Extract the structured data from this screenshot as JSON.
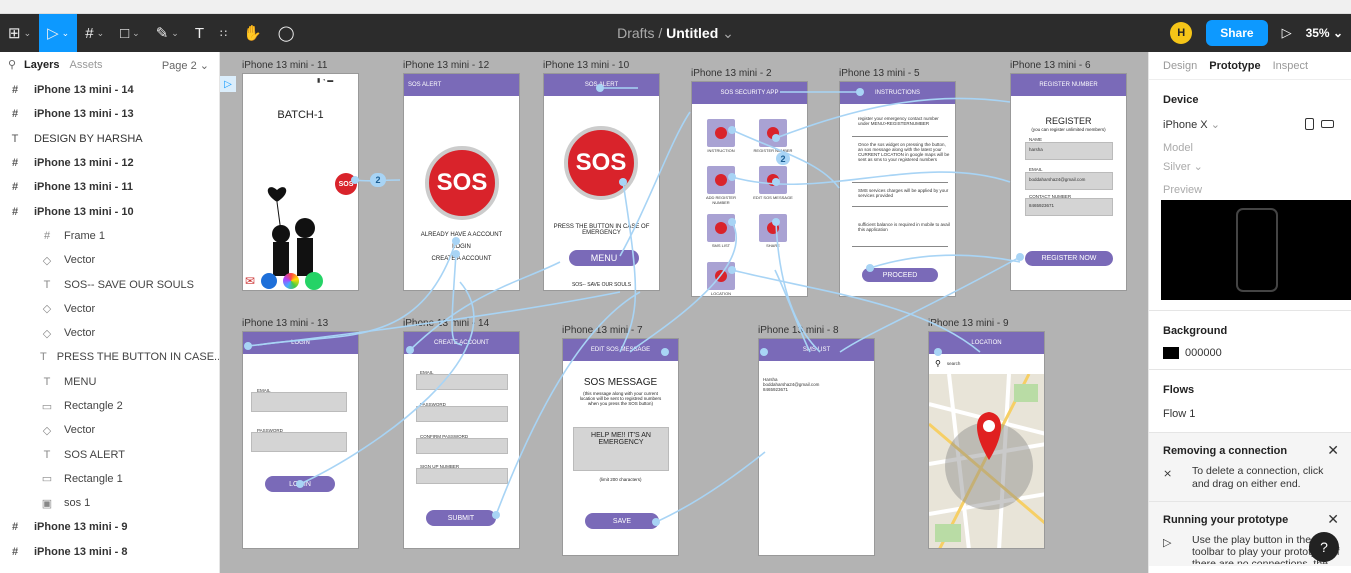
{
  "toolbar": {
    "path_prefix": "Drafts",
    "separator": "/",
    "file_name": "Untitled",
    "avatar_initial": "H",
    "share_label": "Share",
    "zoom": "35%",
    "text_tool": "T"
  },
  "layers_panel": {
    "tab_layers": "Layers",
    "tab_assets": "Assets",
    "page": "Page 2",
    "items": [
      {
        "label": "iPhone 13 mini - 14",
        "type": "frame"
      },
      {
        "label": "iPhone 13 mini - 13",
        "type": "frame"
      },
      {
        "label": "DESIGN BY HARSHA",
        "type": "text"
      },
      {
        "label": "iPhone 13 mini - 12",
        "type": "frame"
      },
      {
        "label": "iPhone 13 mini - 11",
        "type": "frame"
      },
      {
        "label": "iPhone 13 mini - 10",
        "type": "frame"
      },
      {
        "label": "Frame 1",
        "type": "subframe"
      },
      {
        "label": "Vector",
        "type": "vector"
      },
      {
        "label": "SOS-- SAVE OUR SOULS",
        "type": "text"
      },
      {
        "label": "Vector",
        "type": "vector"
      },
      {
        "label": "Vector",
        "type": "vector"
      },
      {
        "label": "PRESS THE BUTTON IN CASE...",
        "type": "text"
      },
      {
        "label": "MENU",
        "type": "text"
      },
      {
        "label": "Rectangle 2",
        "type": "rect"
      },
      {
        "label": "Vector",
        "type": "vector"
      },
      {
        "label": "SOS ALERT",
        "type": "text"
      },
      {
        "label": "Rectangle 1",
        "type": "rect"
      },
      {
        "label": "sos 1",
        "type": "image"
      },
      {
        "label": "iPhone 13 mini - 9",
        "type": "frame"
      },
      {
        "label": "iPhone 13 mini - 8",
        "type": "frame"
      }
    ]
  },
  "canvas": {
    "frame_labels": {
      "f11": "iPhone 13 mini - 11",
      "f12": "iPhone 13 mini - 12",
      "f10": "iPhone 13 mini - 10",
      "f2": "iPhone 13 mini - 2",
      "f5": "iPhone 13 mini - 5",
      "f6": "iPhone 13 mini - 6",
      "f13": "iPhone 13 mini - 13",
      "f14": "iPhone 13 mini - 14",
      "f7": "iPhone 13 mini - 7",
      "f8": "iPhone 13 mini - 8",
      "f9": "iPhone 13 mini - 9"
    },
    "batch_title": "BATCH-1",
    "sos_small": "SOS",
    "connection_badge_1": "2",
    "connection_badge_2": "2",
    "f12_bar": "SOS ALERT",
    "f12_sos": "SOS",
    "f12_have_account": "ALREADY HAVE A ACCOUNT",
    "f12_login": "LOGIN",
    "f12_create": "CREATE A ACCOUNT",
    "f10_bar": "SOS ALERT",
    "f10_sos": "SOS",
    "f10_press": "PRESS THE BUTTON IN CASE OF EMERGENCY",
    "f10_menu": "MENU",
    "f10_footer": "SOS-- SAVE OUR SOULS",
    "f2_bar": "SOS SECURITY APP",
    "f2_items": [
      "INSTRUCTION",
      "REGISTER NUMBER",
      "ADD REGISTER NUMBER",
      "EDIT SOS MESSAGE",
      "SMS LIST",
      "SHARE",
      "LOCATION"
    ],
    "f5_bar": "INSTRUCTIONS",
    "f5_items": [
      "register your emergency contact number under MENU>REGISTERNUMBER",
      "Once the sos widget on pressing the button, an sos message along with the latest your CURRENT LOCATION in google maps will be sent as sms to your registered numbers",
      "SMS services charges will be applied by your services provided",
      "sufficient balance is required in mobile to avail this application"
    ],
    "f5_proceed": "PROCEED",
    "f6_bar": "REGISTER NUMBER",
    "f6_title": "REGISTER",
    "f6_subtitle": "(you can register unlimited members)",
    "f6_fields": [
      "NAME",
      "EMAIL",
      "CONTACT NUMBER"
    ],
    "f6_values": [
      "harsha",
      "boddaharsha24@gmail.com",
      "8465923671"
    ],
    "f6_button": "REGISTER NOW",
    "f13_bar": "LOGIN",
    "f13_fields": [
      "EMAIL",
      "PASSWORD"
    ],
    "f13_button": "LOGIN",
    "f14_bar": "CREATE ACCOUNT",
    "f14_fields": [
      "EMAIL",
      "PASSWORD",
      "CONFIRM PASSWORD",
      "SIGN UP NUMBER"
    ],
    "f14_button": "SUBMIT",
    "f7_bar": "EDIT SOS MESSAGE",
    "f7_title": "SOS MESSAGE",
    "f7_desc": "(this message along with your current location will be sent to registred numbers when you press the SOS button)",
    "f7_message": "HELP ME!! IT'S AN EMERGENCY",
    "f7_limit": "(limit 200 characters)",
    "f7_button": "SAVE",
    "f8_bar": "SMS LIST",
    "f8_entry_name": "Harsha",
    "f8_entry_email": "boddaharsha24@gmail.com",
    "f8_entry_phone": "8465923671",
    "f9_bar": "LOCATION",
    "f9_search": "search"
  },
  "right_panel": {
    "tabs": [
      "Design",
      "Prototype",
      "Inspect"
    ],
    "device_title": "Device",
    "device": "iPhone X",
    "model_label": "Model",
    "model": "Silver",
    "preview_label": "Preview",
    "background_title": "Background",
    "background_hex": "000000",
    "flows_title": "Flows",
    "flow": "Flow 1",
    "removing_title": "Removing a connection",
    "removing_text": "To delete a connection, click and drag on either end.",
    "running_title": "Running your prototype",
    "running_text": "Use the play button in the toolbar to play your prototype. If there are no connections, the",
    "help": "?"
  }
}
